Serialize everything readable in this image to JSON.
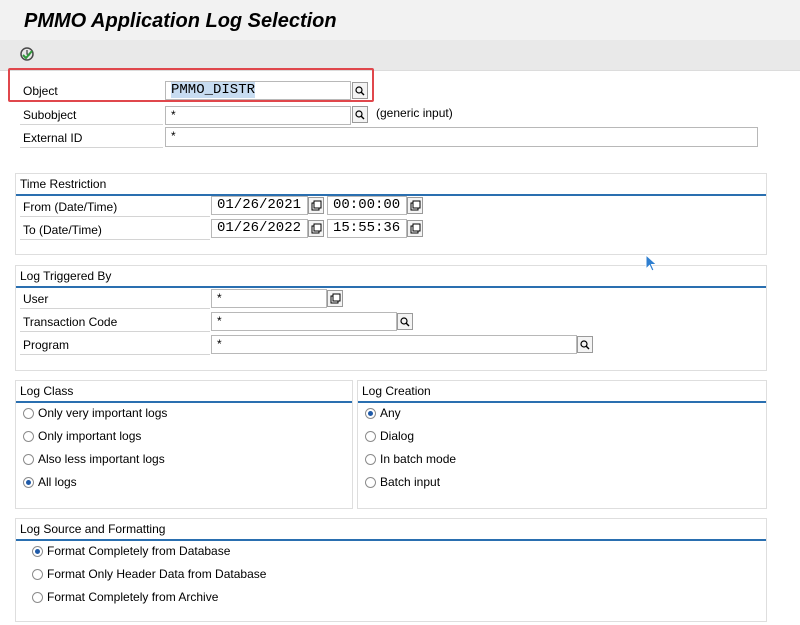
{
  "window": {
    "title": "PMMO Application Log Selection"
  },
  "toolbar": {
    "execute_icon": "execute-clock-icon"
  },
  "selection": {
    "object_label": "Object",
    "object_value": "PMMO_DISTR",
    "subobject_label": "Subobject",
    "subobject_value": "*",
    "subobject_hint": "(generic input)",
    "external_id_label": "External ID",
    "external_id_value": "*"
  },
  "time_restriction": {
    "title": "Time Restriction",
    "from_label": "From (Date/Time)",
    "from_date": "01/26/2021",
    "from_time": "00:00:00",
    "to_label": "To (Date/Time)",
    "to_date": "01/26/2022",
    "to_time": "15:55:36"
  },
  "log_triggered": {
    "title": "Log Triggered By",
    "user_label": "User",
    "user_value": "*",
    "tcode_label": "Transaction Code",
    "tcode_value": "*",
    "program_label": "Program",
    "program_value": "*"
  },
  "log_class": {
    "title": "Log Class",
    "options": [
      "Only very important logs",
      "Only important logs",
      "Also less important logs",
      "All logs"
    ],
    "selected": "All logs"
  },
  "log_creation": {
    "title": "Log Creation",
    "options": [
      "Any",
      "Dialog",
      "In batch mode",
      "Batch input"
    ],
    "selected": "Any"
  },
  "log_source": {
    "title": "Log Source and Formatting",
    "options": [
      "Format Completely from Database",
      "Format Only Header Data from Database",
      "Format Completely from Archive"
    ],
    "selected": "Format Completely from Database"
  }
}
